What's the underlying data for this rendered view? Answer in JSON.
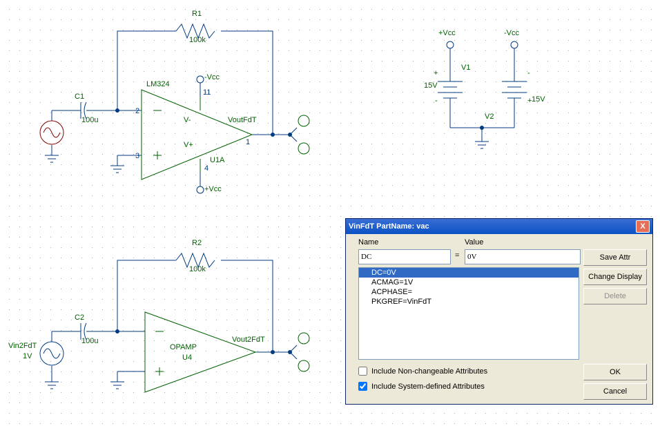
{
  "circuit1": {
    "R": {
      "name": "R1",
      "value": "100k"
    },
    "C": {
      "name": "C1",
      "value": "100u"
    },
    "opamp": {
      "name": "LM324",
      "des": "U1A",
      "pin2": "2",
      "pin3": "3",
      "pin11": "11",
      "pin4": "4",
      "pin1": "1",
      "vm": "V-",
      "vp": "V+",
      "pvcc": "+Vcc",
      "nvcc": "-Vcc"
    },
    "out": "VoutFdT"
  },
  "circuit2": {
    "R": {
      "name": "R2",
      "value": "100k"
    },
    "C": {
      "name": "C2",
      "value": "100u"
    },
    "src": {
      "name": "Vin2FdT",
      "val": "1V"
    },
    "opamp": {
      "name": "OPAMP",
      "des": "U4"
    },
    "out": "Vout2FdT"
  },
  "supply": {
    "pvcc": "+Vcc",
    "nvcc": "-Vcc",
    "v1": {
      "name": "V1",
      "val": "15V",
      "plus": "+",
      "minus": "-"
    },
    "v2": {
      "name": "V2",
      "val": "15V",
      "plus": "+",
      "minus": "-"
    }
  },
  "dialog": {
    "title": "VinFdT  PartName: vac",
    "nameLabel": "Name",
    "valueLabel": "Value",
    "eq": "=",
    "nameField": "DC",
    "valueField": "0V",
    "rows": [
      "DC=0V",
      "ACMAG=1V",
      "ACPHASE=",
      "PKGREF=VinFdT"
    ],
    "selIndex": 0,
    "chk1": "Include Non-changeable Attributes",
    "chk1v": false,
    "chk2": "Include System-defined Attributes",
    "chk2v": true,
    "btnSave": "Save Attr",
    "btnChange": "Change Display",
    "btnDelete": "Delete",
    "btnOK": "OK",
    "btnCancel": "Cancel",
    "close": "X"
  }
}
